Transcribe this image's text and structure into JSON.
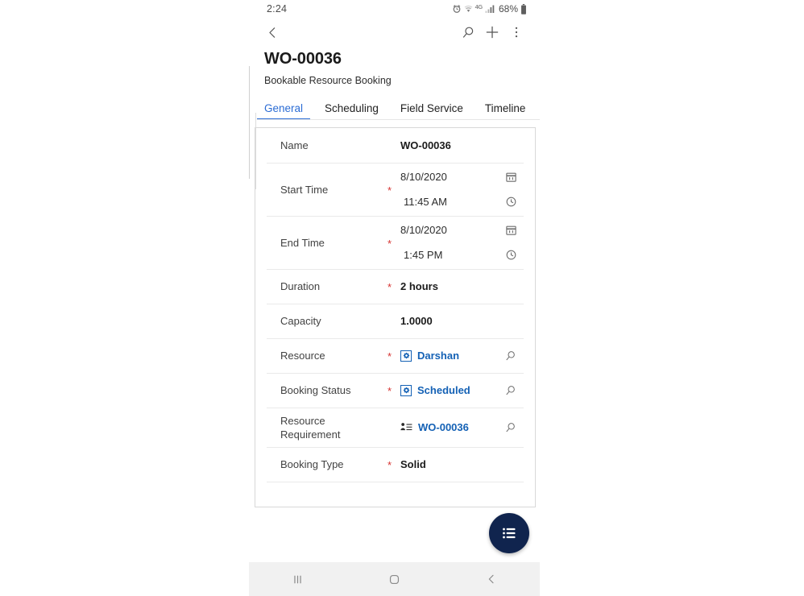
{
  "status_bar": {
    "time": "2:24",
    "network": "4G",
    "battery_pct": "68%",
    "icons": [
      "alarm-icon",
      "wifi-icon",
      "network-4g-icon",
      "signal-bars-icon",
      "battery-icon"
    ]
  },
  "app_bar": {
    "back_label": "back-chevron-icon",
    "search_label": "search-icon",
    "add_label": "plus-icon",
    "more_label": "overflow-menu-icon"
  },
  "record": {
    "title": "WO-00036",
    "entity": "Bookable Resource Booking"
  },
  "tabs": [
    {
      "label": "General",
      "active": true
    },
    {
      "label": "Scheduling",
      "active": false
    },
    {
      "label": "Field Service",
      "active": false
    },
    {
      "label": "Timeline",
      "active": false
    }
  ],
  "form": {
    "fields": [
      {
        "type": "text",
        "label": "Name",
        "required": false,
        "value": "WO-00036"
      },
      {
        "type": "datetime",
        "label": "Start Time",
        "required": true,
        "date": "8/10/2020",
        "time": "11:45 AM",
        "date_icon": "calendar-icon",
        "time_icon": "clock-icon"
      },
      {
        "type": "datetime",
        "label": "End Time",
        "required": true,
        "date": "8/10/2020",
        "time": "1:45 PM",
        "date_icon": "calendar-icon",
        "time_icon": "clock-icon"
      },
      {
        "type": "text",
        "label": "Duration",
        "required": true,
        "value": "2 hours"
      },
      {
        "type": "text",
        "label": "Capacity",
        "required": false,
        "value": "1.0000"
      },
      {
        "type": "lookup",
        "label": "Resource",
        "required": true,
        "value": "Darshan",
        "entity_icon": "bookable-resource-icon",
        "trailing_icon": "lookup-search-icon"
      },
      {
        "type": "lookup",
        "label": "Booking Status",
        "required": true,
        "value": "Scheduled",
        "entity_icon": "booking-status-icon",
        "trailing_icon": "lookup-search-icon"
      },
      {
        "type": "lookup",
        "label": "Resource Requirement",
        "required": false,
        "value": "WO-00036",
        "entity_icon": "resource-requirement-icon",
        "trailing_icon": "lookup-search-icon"
      },
      {
        "type": "text",
        "label": "Booking Type",
        "required": true,
        "value": "Solid"
      }
    ]
  },
  "fab": {
    "icon": "list-menu-icon"
  },
  "nav_bar": {
    "recents": "recents-icon",
    "home": "home-icon",
    "back": "back-icon"
  },
  "colors": {
    "accent_blue": "#2b6cd4",
    "link_blue": "#1461b5",
    "required_red": "#d63230",
    "fab_navy": "#10244e"
  }
}
